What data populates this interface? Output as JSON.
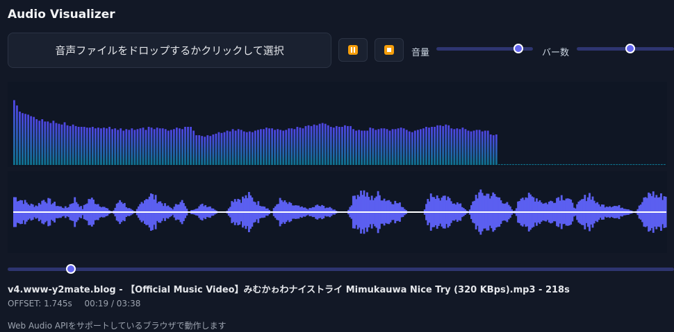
{
  "app": {
    "title": "Audio Visualizer"
  },
  "dropzone": {
    "label": "音声ファイルをドロップするかクリックして選択"
  },
  "controls": {
    "volume_label": "音量",
    "bars_label": "バー数",
    "volume_level": 0.85,
    "bars_level": 0.55
  },
  "seek": {
    "level": 0.095
  },
  "file": {
    "name": "v4.www-y2mate.blog - 【Official Music Video】みむかゎわナイストライ Mimukauwa Nice Try (320 KBps).mp3 - 218s"
  },
  "status": {
    "offset": "OFFSET: 1.745s",
    "time": "00:19 / 03:38"
  },
  "support_note": "Web Audio APIをサポートしているブラウザで動作します",
  "colors": {
    "accent": "#6366f1",
    "bar_top": "#4f46e5",
    "bar_bottom": "#0e7490",
    "wave": "#5b5ff0",
    "icon": "#f59e0b"
  },
  "icons": {
    "pause": "pause-icon",
    "stop": "stop-icon"
  },
  "spectrum": {
    "bar_count": 139,
    "levels": [
      0.85,
      0.78,
      0.7,
      0.68,
      0.67,
      0.66,
      0.64,
      0.63,
      0.6,
      0.58,
      0.6,
      0.57,
      0.57,
      0.55,
      0.58,
      0.55,
      0.54,
      0.53,
      0.56,
      0.52,
      0.51,
      0.53,
      0.51,
      0.5,
      0.5,
      0.5,
      0.49,
      0.49,
      0.5,
      0.48,
      0.49,
      0.48,
      0.49,
      0.48,
      0.5,
      0.47,
      0.48,
      0.46,
      0.48,
      0.45,
      0.47,
      0.46,
      0.48,
      0.46,
      0.47,
      0.48,
      0.49,
      0.46,
      0.5,
      0.49,
      0.47,
      0.49,
      0.48,
      0.48,
      0.47,
      0.45,
      0.46,
      0.47,
      0.49,
      0.48,
      0.47,
      0.5,
      0.5,
      0.5,
      0.45,
      0.39,
      0.39,
      0.38,
      0.37,
      0.39,
      0.38,
      0.4,
      0.41,
      0.43,
      0.42,
      0.43,
      0.45,
      0.44,
      0.47,
      0.45,
      0.47,
      0.46,
      0.44,
      0.43,
      0.44,
      0.43,
      0.45,
      0.46,
      0.47,
      0.47,
      0.49,
      0.48,
      0.48,
      0.46,
      0.47,
      0.46,
      0.45,
      0.46,
      0.48,
      0.48,
      0.47,
      0.5,
      0.49,
      0.48,
      0.51,
      0.52,
      0.51,
      0.53,
      0.52,
      0.54,
      0.55,
      0.54,
      0.52,
      0.5,
      0.49,
      0.51,
      0.5,
      0.5,
      0.52,
      0.51,
      0.51,
      0.47,
      0.45,
      0.46,
      0.45,
      0.45,
      0.45,
      0.49,
      0.48,
      0.46,
      0.47,
      0.48,
      0.48,
      0.47,
      0.45,
      0.47,
      0.47,
      0.48,
      0.49,
      0.48,
      0.46,
      0.44,
      0.43,
      0.45,
      0.46,
      0.47,
      0.48,
      0.5,
      0.49,
      0.5,
      0.5,
      0.52,
      0.52,
      0.51,
      0.53,
      0.52,
      0.48,
      0.47,
      0.48,
      0.47,
      0.49,
      0.47,
      0.45,
      0.44,
      0.45,
      0.46,
      0.46,
      0.44,
      0.45,
      0.45,
      0.4,
      0.39,
      0.4,
      0.01,
      0.01,
      0.01,
      0.01,
      0.01,
      0.01,
      0.01,
      0.01,
      0.01,
      0.01,
      0.01,
      0.01,
      0.01,
      0.01,
      0.01,
      0.01,
      0.01,
      0.01,
      0.01,
      0.01,
      0.01,
      0.01,
      0.01,
      0.01,
      0.01,
      0.01,
      0.01,
      0.01,
      0.01,
      0.01,
      0.01,
      0.01,
      0.01,
      0.01,
      0.01,
      0.01,
      0.01,
      0.01,
      0.01,
      0.01,
      0.01,
      0.01,
      0.01,
      0.01,
      0.01,
      0.01,
      0.01,
      0.01,
      0.01,
      0.01,
      0.01,
      0.01,
      0.01,
      0.01,
      0.01,
      0.01,
      0.01,
      0.01,
      0.01,
      0.01
    ]
  },
  "waveform": {
    "envelope": [
      0.7,
      0.55,
      0.35,
      0.3,
      0.6,
      0.45,
      0.25,
      0.2,
      0.6,
      0.15,
      0.65,
      0.4,
      0.2,
      0.0,
      0.6,
      0.2,
      0.0,
      0.55,
      0.8,
      0.55,
      0.3,
      0.15,
      0.6,
      0.0,
      0.2,
      0.35,
      0.25,
      0.0,
      0.0,
      0.65,
      0.6,
      0.75,
      0.45,
      0.3,
      0.0,
      0.55,
      0.4,
      0.3,
      0.2,
      0.15,
      0.3,
      0.25,
      0.15,
      0.0,
      0.0,
      0.8,
      0.95,
      0.6,
      0.8,
      0.6,
      0.5,
      0.35,
      0.0,
      0.0,
      0.0,
      0.85,
      0.65,
      0.6,
      0.5,
      0.3,
      0.0,
      0.8,
      0.85,
      0.8,
      0.65,
      0.4,
      0.0,
      0.8,
      0.7,
      0.65,
      0.4,
      0.5,
      0.75,
      0.7,
      0.2,
      0.55,
      0.85,
      0.35,
      0.3,
      0.3,
      0.25,
      0.15,
      0.0,
      0.5,
      0.9,
      0.7,
      0.75
    ]
  }
}
